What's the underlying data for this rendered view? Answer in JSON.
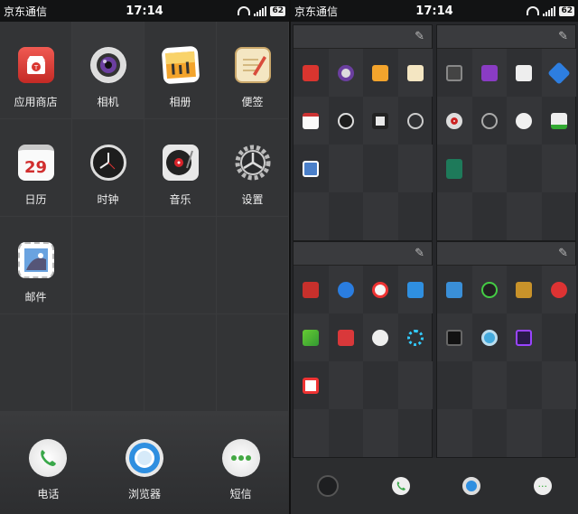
{
  "status": {
    "carrier": "京东通信",
    "time": "17:14",
    "battery": "62"
  },
  "left": {
    "apps": [
      {
        "name": "app-store",
        "label": "应用商店",
        "icon": "store-icon",
        "color": "#d9352f"
      },
      {
        "name": "camera",
        "label": "相机",
        "icon": "camera-icon",
        "color": "#e5e5e5"
      },
      {
        "name": "gallery",
        "label": "相册",
        "icon": "gallery-icon",
        "color": "#f0b33a"
      },
      {
        "name": "notes",
        "label": "便签",
        "icon": "notes-icon",
        "color": "#f4e6c2"
      },
      {
        "name": "calendar",
        "label": "日历",
        "icon": "calendar-icon",
        "color": "#fafafa",
        "day": "29"
      },
      {
        "name": "clock",
        "label": "时钟",
        "icon": "clock-icon",
        "color": "#1d1d1d"
      },
      {
        "name": "music",
        "label": "音乐",
        "icon": "music-icon",
        "color": "#e8e8e8"
      },
      {
        "name": "settings",
        "label": "设置",
        "icon": "gear-icon",
        "color": "#aaaaaa"
      },
      {
        "name": "mail",
        "label": "邮件",
        "icon": "mail-icon",
        "color": "#4a7fc9"
      }
    ],
    "dock": [
      {
        "name": "phone",
        "label": "电话",
        "icon": "phone-icon"
      },
      {
        "name": "browser",
        "label": "浏览器",
        "icon": "browser-icon"
      },
      {
        "name": "sms",
        "label": "短信",
        "icon": "sms-icon"
      }
    ]
  },
  "right": {
    "panels": [
      {
        "icons": [
          "store-icon",
          "camera-icon",
          "gallery-icon",
          "notes-icon",
          "calendar-icon",
          "clock-icon",
          "music-icon",
          "settings-icon",
          "mail-icon"
        ]
      },
      {
        "icons": [
          "calculator-icon",
          "game-icon",
          "cloud-icon",
          "navigation-icon",
          "record-icon",
          "search-icon",
          "weather-icon",
          "download-icon",
          "file-icon"
        ]
      },
      {
        "icons": [
          "red-app-icon",
          "chat-icon",
          "weibo-icon",
          "mail-send-icon",
          "send-icon",
          "flickr-icon",
          "white-circle-icon",
          "ring-icon",
          "wps-icon"
        ]
      },
      {
        "icons": [
          "folder-icon",
          "play-icon",
          "game-box-icon",
          "bug-icon",
          "camera2-icon",
          "disc-icon",
          "video-icon"
        ]
      }
    ],
    "pencil": "✎"
  }
}
